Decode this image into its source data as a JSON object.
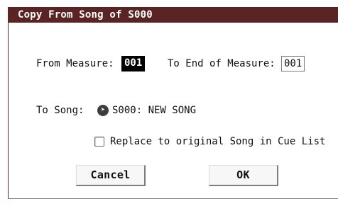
{
  "dialog": {
    "title": "Copy From Song of S000"
  },
  "measure": {
    "from_label": "From Measure:",
    "from_value": "001",
    "to_label": "To End of Measure:",
    "to_value": "001"
  },
  "song": {
    "label": "To Song:",
    "icon": "arrow-right-circle-icon",
    "value": "S000: NEW SONG"
  },
  "replace": {
    "label": "Replace to original Song in Cue List",
    "checked": false
  },
  "buttons": {
    "cancel": "Cancel",
    "ok": "OK"
  },
  "colors": {
    "titlebar": "#5a2424",
    "selected_bg": "#000000",
    "accent_text": "#ffffff"
  }
}
